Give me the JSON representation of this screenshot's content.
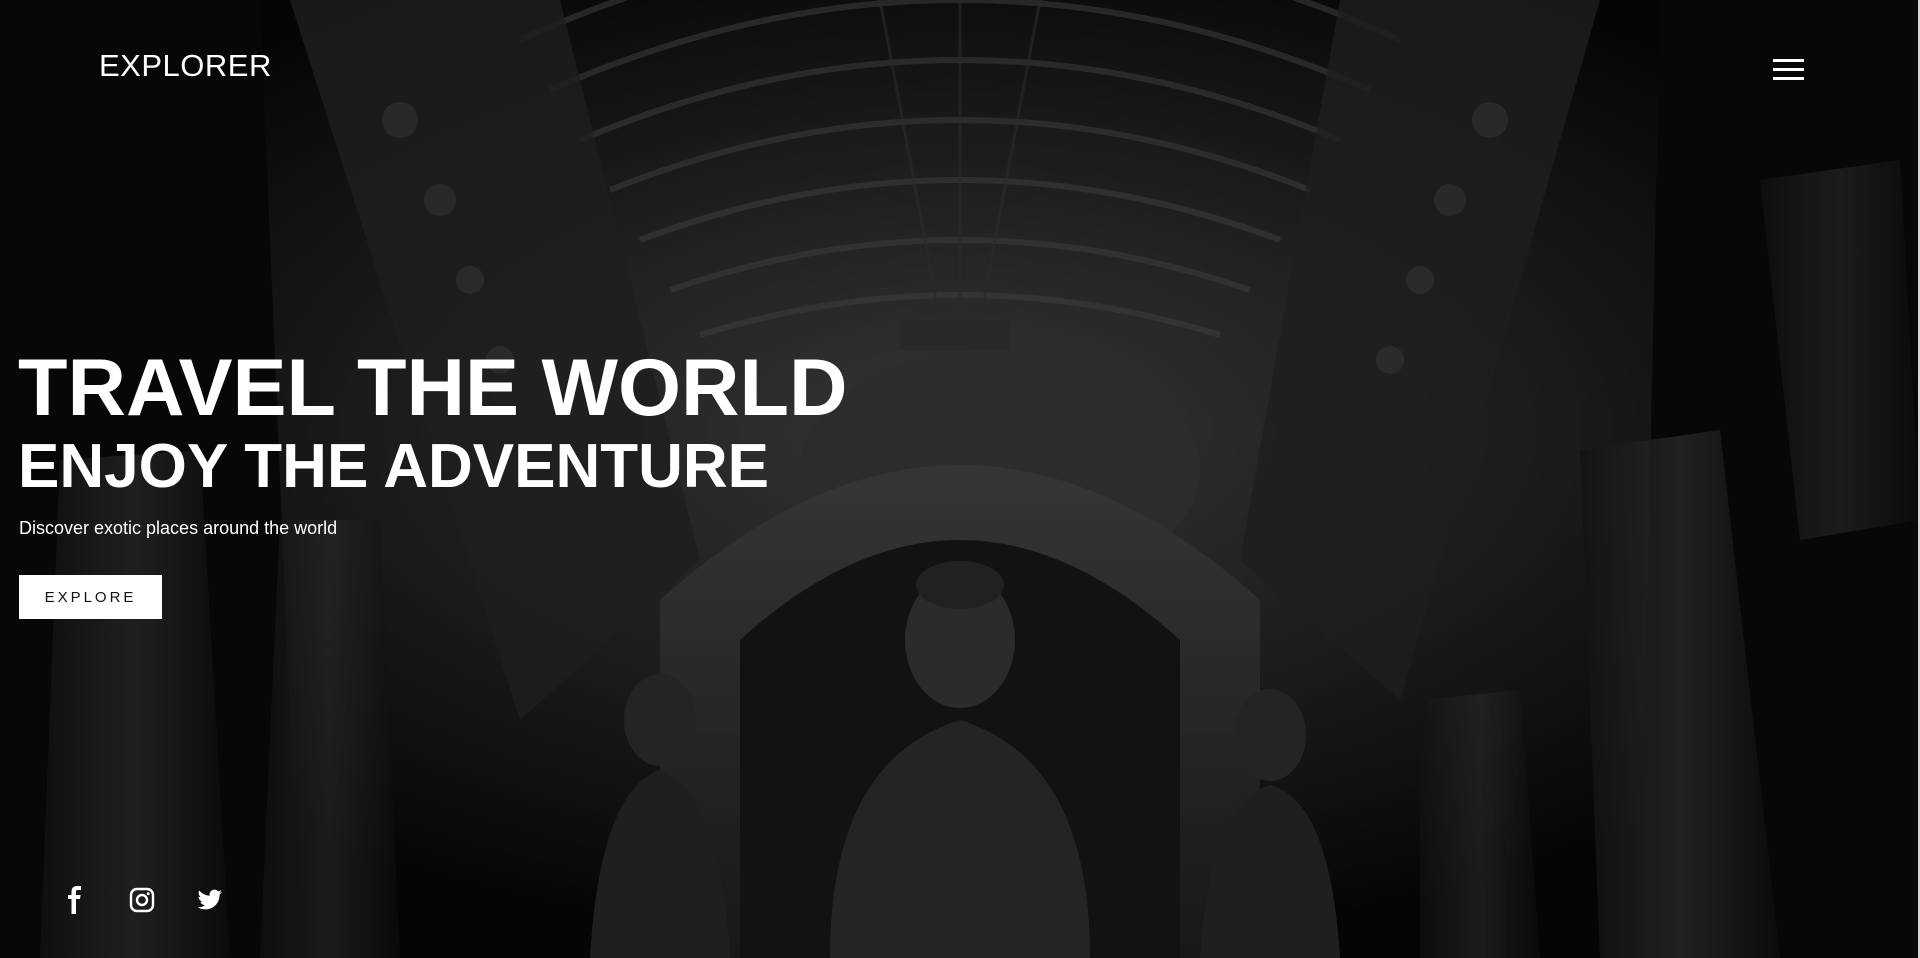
{
  "header": {
    "logo_text": "EXPLORER",
    "menu_icon": "hamburger-menu-icon"
  },
  "hero": {
    "title": "TRAVEL THE WORLD",
    "subtitle": "ENJOY THE ADVENTURE",
    "tagline": "Discover exotic places around the world",
    "button_label": "EXPLORE",
    "background": "dark cave temple interior with carved Buddha statue"
  },
  "social": {
    "items": [
      {
        "icon": "facebook-icon"
      },
      {
        "icon": "instagram-icon"
      },
      {
        "icon": "twitter-icon"
      }
    ]
  },
  "colors": {
    "background": "#000000",
    "text": "#ffffff",
    "button_bg": "#ffffff",
    "button_text": "#111111"
  }
}
